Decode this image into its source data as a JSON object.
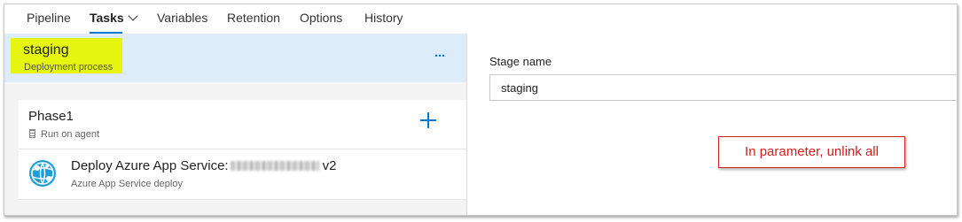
{
  "tabs": [
    {
      "label": "Pipeline"
    },
    {
      "label": "Tasks"
    },
    {
      "label": "Variables"
    },
    {
      "label": "Retention"
    },
    {
      "label": "Options"
    },
    {
      "label": "History"
    }
  ],
  "stage": {
    "name": "staging",
    "subtitle": "Deployment process",
    "more_label": "···"
  },
  "phase": {
    "title": "Phase1",
    "subtitle": "Run on agent"
  },
  "task": {
    "title_prefix": "Deploy Azure App Service:",
    "title_suffix": "v2",
    "subtitle": "Azure App Service deploy"
  },
  "detail": {
    "field_label": "Stage name",
    "field_value": "staging"
  },
  "annotation": {
    "text": "In parameter, unlink all"
  },
  "colors": {
    "accent": "#0078d4",
    "stage_bg": "#deecf9",
    "highlight": "#e6f50f",
    "annotation": "#d02020"
  },
  "icons": {
    "tasks_tab": "chevron-down-icon",
    "phase": "agent-server-icon",
    "add": "plus-icon",
    "task": "azure-app-service-icon"
  }
}
